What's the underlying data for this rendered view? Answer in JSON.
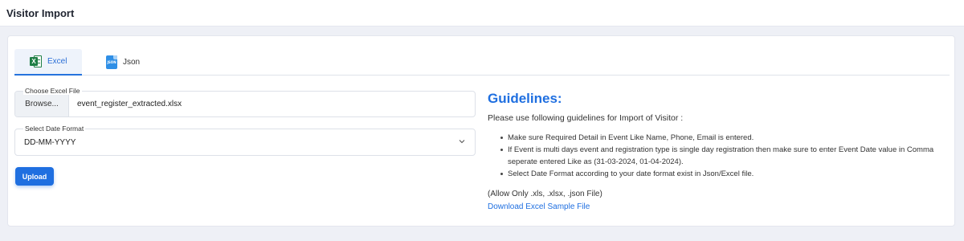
{
  "header": {
    "title": "Visitor Import"
  },
  "tabs": [
    {
      "label": "Excel",
      "icon": "excel-icon",
      "active": true
    },
    {
      "label": "Json",
      "icon": "json-icon",
      "active": false
    }
  ],
  "form": {
    "file_label": "Choose Excel File",
    "browse_label": "Browse...",
    "file_name": "event_register_extracted.xlsx",
    "date_format_label": "Select Date Format",
    "date_format_value": "DD-MM-YYYY",
    "upload_label": "Upload"
  },
  "guidelines": {
    "title": "Guidelines:",
    "intro": "Please use following guidelines for Import of Visitor :",
    "items": [
      "Make sure Required Detail in Event Like Name, Phone, Email is entered.",
      "If Event is multi days event and registration type is single day registration then make sure to enter Event Date value in Comma seperate entered Like as (31-03-2024, 01-04-2024).",
      "Select Date Format according to your date format exist in Json/Excel file."
    ],
    "allowed": "(Allow Only .xls, .xlsx, .json File)",
    "download_link": "Download Excel Sample File"
  },
  "colors": {
    "accent": "#1f6fe0",
    "excel_green": "#1e7e45",
    "json_blue": "#2f8fe6",
    "background": "#eef0f6"
  }
}
